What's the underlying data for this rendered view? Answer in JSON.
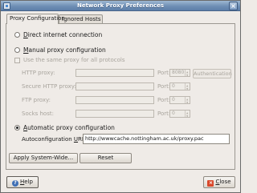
{
  "window": {
    "title": "Network Proxy Preferences"
  },
  "tabs": [
    {
      "label": "Proxy Configuration"
    },
    {
      "label": "Ignored Hosts"
    }
  ],
  "options": {
    "direct": {
      "prefix": "",
      "accel": "D",
      "rest": "irect internet connection"
    },
    "manual": {
      "prefix": "",
      "accel": "M",
      "rest": "anual proxy configuration"
    },
    "same_proxy": "Use the same proxy for all protocols",
    "automatic": {
      "prefix": "",
      "accel": "A",
      "rest": "utomatic proxy configuration",
      "selected": true
    }
  },
  "proxies": [
    {
      "label": "HTTP proxy:",
      "port": "8080"
    },
    {
      "label": "Secure HTTP proxy:",
      "port": "0"
    },
    {
      "label": "FTP proxy:",
      "port": "0"
    },
    {
      "label": "Socks host:",
      "port": "0"
    }
  ],
  "port_label": "Port:",
  "authentication_label": "Authentication",
  "autoconfig": {
    "label_prefix": "Autoconfiguration ",
    "label_accel": "U",
    "label_rest": "RL:",
    "value": "http://wwwcache.nottingham.ac.uk/proxy.pac"
  },
  "buttons": {
    "apply": "Apply System-Wide...",
    "reset": "Reset",
    "help_accel": "H",
    "help_rest": "elp",
    "close_accel": "C",
    "close_rest": "lose"
  },
  "icons": {
    "help": "help-icon",
    "close": "close-icon",
    "app": "network-icon"
  }
}
